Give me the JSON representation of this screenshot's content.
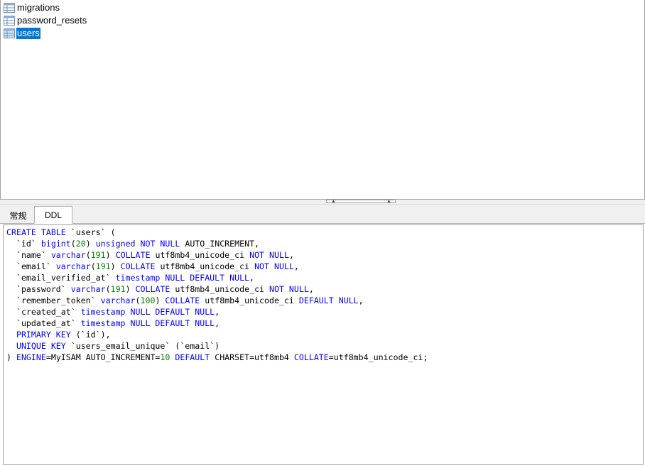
{
  "tables": [
    {
      "name": "migrations",
      "selected": false
    },
    {
      "name": "password_resets",
      "selected": false
    },
    {
      "name": "users",
      "selected": true
    }
  ],
  "tabs": [
    {
      "label": "常规",
      "active": false
    },
    {
      "label": "DDL",
      "active": true
    }
  ],
  "ddl": [
    [
      [
        "kw",
        "CREATE TABLE"
      ],
      [
        "txt",
        " `users` ("
      ]
    ],
    [
      [
        "txt",
        "  `id` "
      ],
      [
        "kw",
        "bigint"
      ],
      [
        "txt",
        "("
      ],
      [
        "num",
        "20"
      ],
      [
        "txt",
        ") "
      ],
      [
        "kw",
        "unsigned NOT NULL"
      ],
      [
        "txt",
        " AUTO_INCREMENT,"
      ]
    ],
    [
      [
        "txt",
        "  `name` "
      ],
      [
        "kw",
        "varchar"
      ],
      [
        "txt",
        "("
      ],
      [
        "num",
        "191"
      ],
      [
        "txt",
        ") "
      ],
      [
        "kw",
        "COLLATE"
      ],
      [
        "txt",
        " utf8mb4_unicode_ci "
      ],
      [
        "kw",
        "NOT NULL"
      ],
      [
        "txt",
        ","
      ]
    ],
    [
      [
        "txt",
        "  `email` "
      ],
      [
        "kw",
        "varchar"
      ],
      [
        "txt",
        "("
      ],
      [
        "num",
        "191"
      ],
      [
        "txt",
        ") "
      ],
      [
        "kw",
        "COLLATE"
      ],
      [
        "txt",
        " utf8mb4_unicode_ci "
      ],
      [
        "kw",
        "NOT NULL"
      ],
      [
        "txt",
        ","
      ]
    ],
    [
      [
        "txt",
        "  `email_verified_at` "
      ],
      [
        "kw",
        "timestamp NULL DEFAULT NULL"
      ],
      [
        "txt",
        ","
      ]
    ],
    [
      [
        "txt",
        "  `password` "
      ],
      [
        "kw",
        "varchar"
      ],
      [
        "txt",
        "("
      ],
      [
        "num",
        "191"
      ],
      [
        "txt",
        ") "
      ],
      [
        "kw",
        "COLLATE"
      ],
      [
        "txt",
        " utf8mb4_unicode_ci "
      ],
      [
        "kw",
        "NOT NULL"
      ],
      [
        "txt",
        ","
      ]
    ],
    [
      [
        "txt",
        "  `remember_token` "
      ],
      [
        "kw",
        "varchar"
      ],
      [
        "txt",
        "("
      ],
      [
        "num",
        "100"
      ],
      [
        "txt",
        ") "
      ],
      [
        "kw",
        "COLLATE"
      ],
      [
        "txt",
        " utf8mb4_unicode_ci "
      ],
      [
        "kw",
        "DEFAULT NULL"
      ],
      [
        "txt",
        ","
      ]
    ],
    [
      [
        "txt",
        "  `created_at` "
      ],
      [
        "kw",
        "timestamp NULL DEFAULT NULL"
      ],
      [
        "txt",
        ","
      ]
    ],
    [
      [
        "txt",
        "  `updated_at` "
      ],
      [
        "kw",
        "timestamp NULL DEFAULT NULL"
      ],
      [
        "txt",
        ","
      ]
    ],
    [
      [
        "txt",
        "  "
      ],
      [
        "kw",
        "PRIMARY KEY"
      ],
      [
        "txt",
        " (`id`),"
      ]
    ],
    [
      [
        "txt",
        "  "
      ],
      [
        "kw",
        "UNIQUE KEY"
      ],
      [
        "txt",
        " `users_email_unique` (`email`)"
      ]
    ],
    [
      [
        "txt",
        ") "
      ],
      [
        "kw",
        "ENGINE"
      ],
      [
        "txt",
        "=MyISAM AUTO_INCREMENT="
      ],
      [
        "num",
        "10"
      ],
      [
        "txt",
        " "
      ],
      [
        "kw",
        "DEFAULT"
      ],
      [
        "txt",
        " CHARSET=utf8mb4 "
      ],
      [
        "kw",
        "COLLATE"
      ],
      [
        "txt",
        "=utf8mb4_unicode_ci;"
      ]
    ]
  ],
  "colors": {
    "keyword": "#0000ff",
    "number": "#008000",
    "selection": "#0078d7"
  },
  "icons": {
    "table": "table-icon"
  }
}
